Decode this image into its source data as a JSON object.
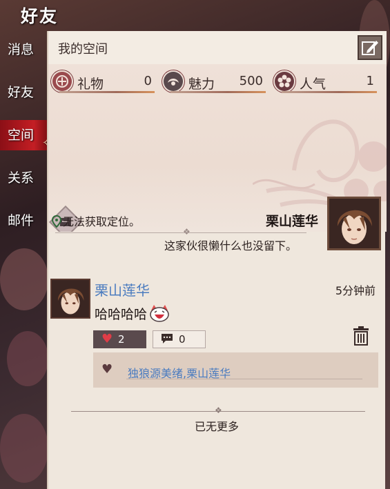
{
  "header": {
    "title": "好友"
  },
  "nav": {
    "items": [
      {
        "label": "消息"
      },
      {
        "label": "好友"
      },
      {
        "label": "空间"
      },
      {
        "label": "关系"
      },
      {
        "label": "邮件"
      }
    ],
    "active_index": 2
  },
  "panel": {
    "title": "我的空间",
    "stats": [
      {
        "icon": "gift-icon",
        "label": "礼物",
        "value": "0"
      },
      {
        "icon": "charm-icon",
        "label": "魅力",
        "value": "500"
      },
      {
        "icon": "popularity-icon",
        "label": "人气",
        "value": "1"
      }
    ],
    "location": "无法获取定位。",
    "owner_name": "栗山莲华",
    "bio": "这家伙很懒什么也没留下。"
  },
  "feed": {
    "posts": [
      {
        "author": "栗山莲华",
        "time": "5分钟前",
        "content": "哈哈哈哈",
        "likes": "2",
        "comments": "0",
        "likers": "独狼源美绪,栗山莲华"
      }
    ],
    "end_text": "已无更多"
  },
  "colors": {
    "accent_red": "#c41e24",
    "name_blue": "#4a7bbf",
    "panel_bg": "#efe7dd"
  }
}
